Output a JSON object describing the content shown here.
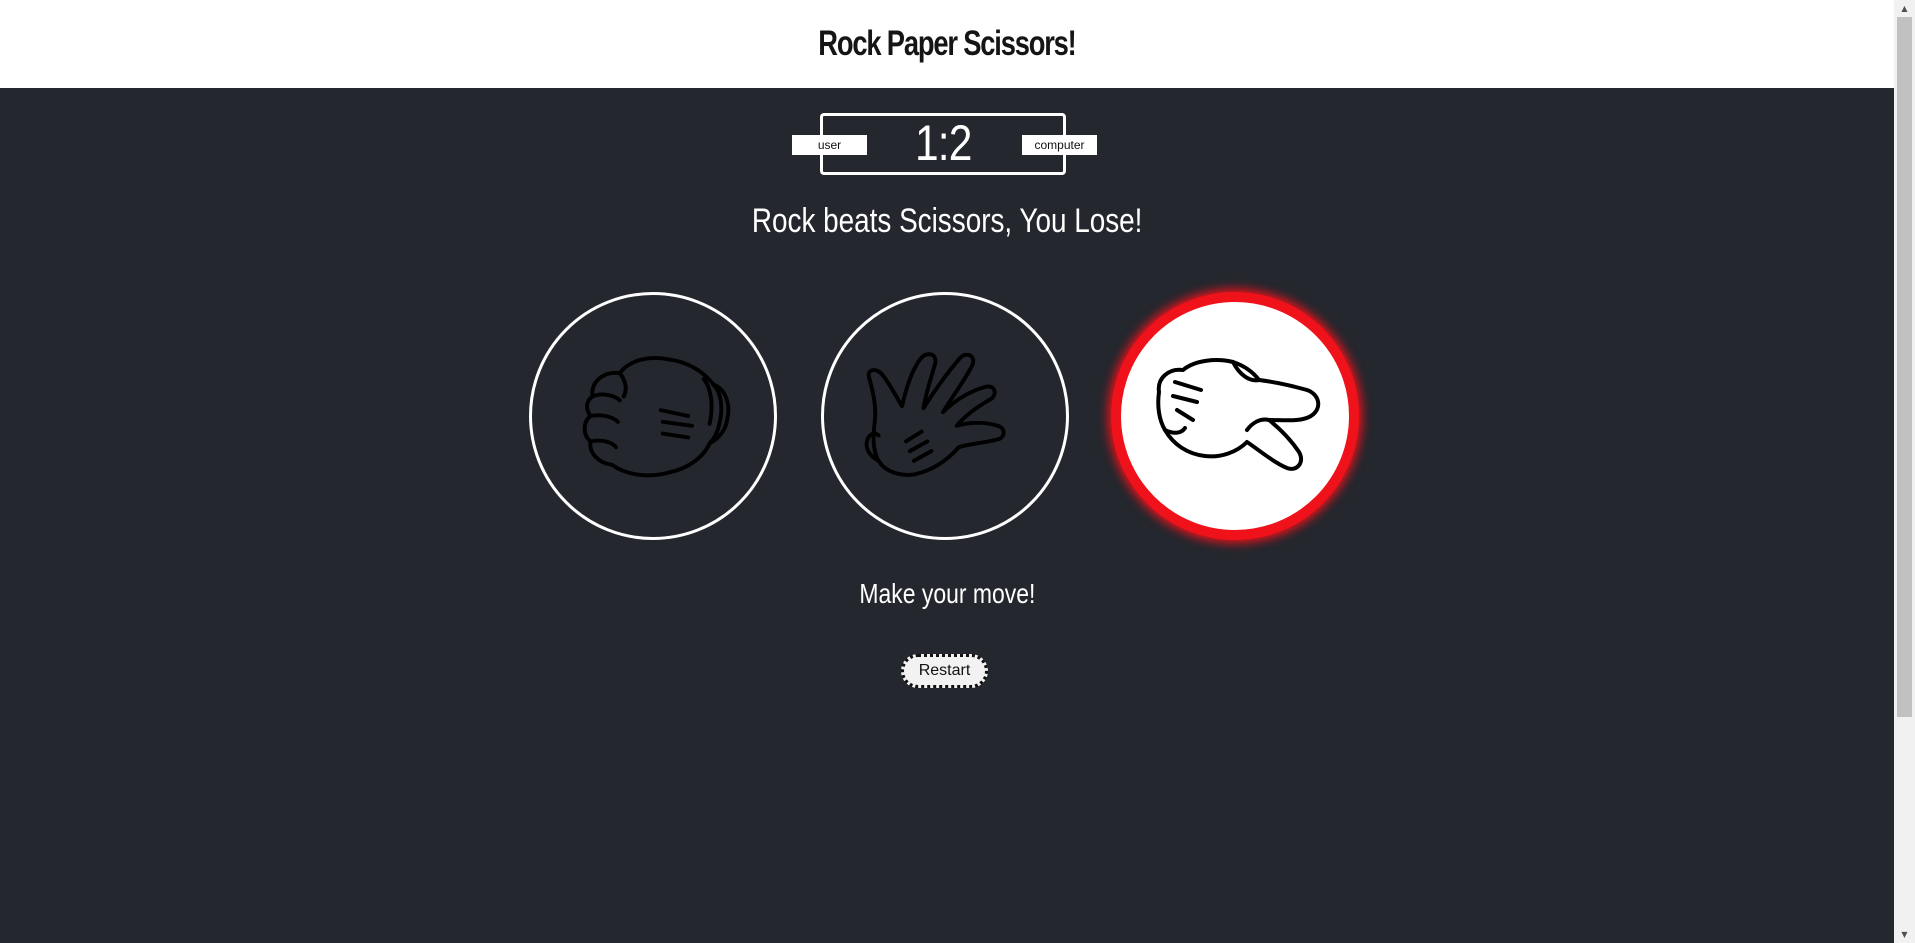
{
  "header": {
    "title": "Rock Paper Scissors!"
  },
  "scoreboard": {
    "user_label": "user",
    "computer_label": "computer",
    "score": "1:2"
  },
  "result": {
    "message": "Rock beats Scissors, You Lose!"
  },
  "choices": [
    {
      "name": "rock",
      "icon": "rock-hand-icon",
      "selected": false
    },
    {
      "name": "paper",
      "icon": "paper-hand-icon",
      "selected": false
    },
    {
      "name": "scissors",
      "icon": "scissors-hand-icon",
      "selected": true
    }
  ],
  "prompt": {
    "text": "Make your move!"
  },
  "controls": {
    "restart_label": "Restart"
  },
  "colors": {
    "background": "#24272e",
    "header_bg": "#ffffff",
    "selected_ring": "#ef121b"
  }
}
